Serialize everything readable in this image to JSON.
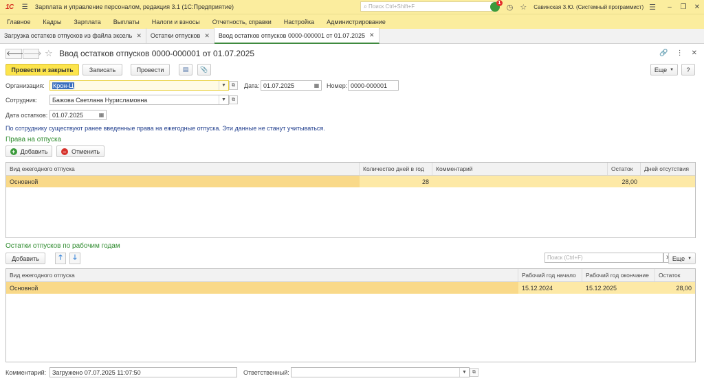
{
  "app": {
    "logo": "1С",
    "title": "Зарплата и управление персоналом, редакция 3.1  (1С:Предприятие)",
    "search_placeholder": "Поиск Ctrl+Shift+F",
    "notification_count": "1",
    "user": "Савинская З.Ю. (Системный программист)"
  },
  "menu": [
    "Главное",
    "Кадры",
    "Зарплата",
    "Выплаты",
    "Налоги и взносы",
    "Отчетность, справки",
    "Настройка",
    "Администрирование"
  ],
  "tabs": [
    {
      "label": "Загрузка остатков отпусков из файла эксель"
    },
    {
      "label": "Остатки отпусков"
    },
    {
      "label": "Ввод остатков отпусков 0000-000001 от 01.07.2025"
    }
  ],
  "form": {
    "title": "Ввод остатков отпусков 0000-000001 от 01.07.2025",
    "buttons": {
      "post_close": "Провести и закрыть",
      "save": "Записать",
      "post": "Провести",
      "more": "Еще",
      "help": "?"
    },
    "org_label": "Организация:",
    "org_value": "Крон-Ц",
    "date_label": "Дата:",
    "date_value": "01.07.2025",
    "number_label": "Номер:",
    "number_value": "0000-000001",
    "employee_label": "Сотрудник:",
    "employee_value": "Бажова Светлана Нурисламовна",
    "balance_date_label": "Дата остатков:",
    "balance_date_value": "01.07.2025",
    "info": "По сотруднику существуют ранее введенные права на ежегодные отпуска. Эти данные не станут учитываться.",
    "comment_label": "Комментарий:",
    "comment_value": "Загружено 07.07.2025 11:07:50",
    "responsible_label": "Ответственный:",
    "responsible_value": ""
  },
  "rights": {
    "title": "Права на отпуска",
    "add": "Добавить",
    "cancel": "Отменить",
    "columns": [
      "Вид ежегодного отпуска",
      "Количество дней в год",
      "Комментарий",
      "Остаток",
      "Дней отсутствия"
    ],
    "rows": [
      {
        "type": "Основной",
        "days": "28",
        "comment": "",
        "balance": "28,00",
        "absence": ""
      }
    ]
  },
  "years": {
    "title": "Остатки отпусков по рабочим годам",
    "add": "Добавить",
    "search_placeholder": "Поиск (Ctrl+F)",
    "more": "Еще",
    "columns": [
      "Вид ежегодного отпуска",
      "Рабочий год начало",
      "Рабочий год окончание",
      "Остаток"
    ],
    "rows": [
      {
        "type": "Основной",
        "start": "15.12.2024",
        "end": "15.12.2025",
        "balance": "28,00"
      }
    ]
  }
}
